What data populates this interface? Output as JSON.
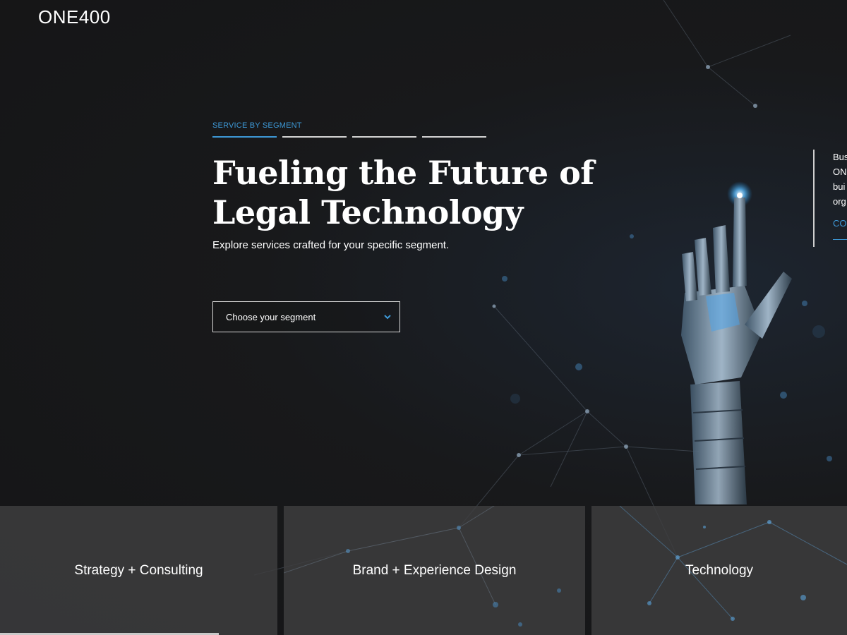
{
  "brand": {
    "logo_text": "ONE400"
  },
  "hero": {
    "eyebrow": "SERVICE BY SEGMENT",
    "headline": "Fueling the Future of Legal Technology",
    "subhead": "Explore services crafted for your specific segment.",
    "segment_select": {
      "selected_label": "Choose your segment",
      "icon": "chevron-down-icon"
    }
  },
  "side_card": {
    "lines": [
      "Bus",
      "ON",
      "bui",
      "org"
    ],
    "cta_label": "CO"
  },
  "services": [
    {
      "label": "Strategy + Consulting"
    },
    {
      "label": "Brand + Experience Design"
    },
    {
      "label": "Technology"
    }
  ],
  "colors": {
    "accent": "#3d98d6",
    "background": "#18191b",
    "tile": "#3e3e40"
  }
}
